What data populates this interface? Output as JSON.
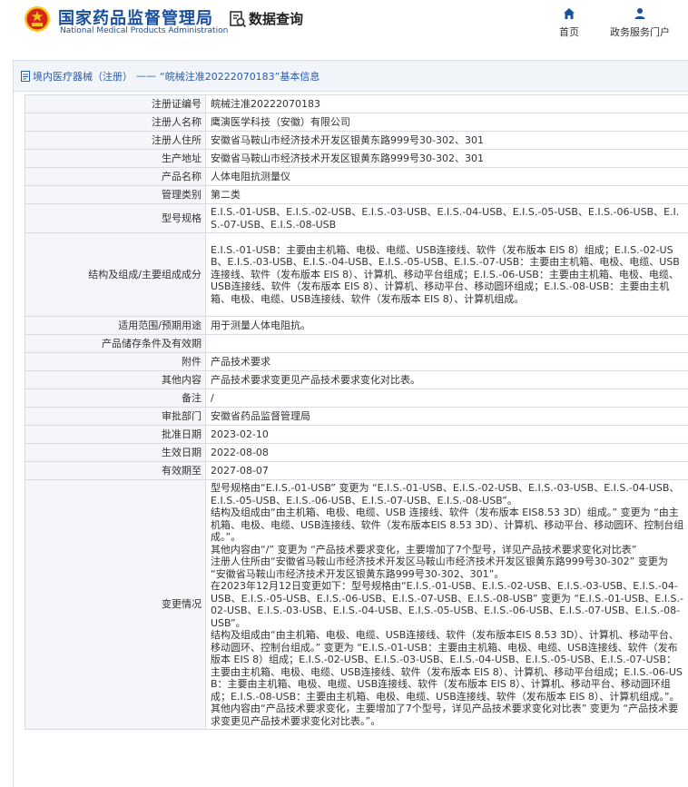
{
  "header": {
    "logo_cn": "国家药品监督管理局",
    "logo_en": "National Medical Products Administration",
    "query_label": "数据查询",
    "nav": [
      {
        "label": "首页",
        "icon": "home-icon"
      },
      {
        "label": "政务服务门户",
        "icon": "user-icon"
      }
    ]
  },
  "breadcrumb": {
    "link": "境内医疗器械（注册）",
    "separator": "——",
    "current": "“皖械注准20222070183”基本信息"
  },
  "rows": [
    {
      "label": "注册证编号",
      "value": "皖械注准20222070183"
    },
    {
      "label": "注册人名称",
      "value": "鹰演医学科技（安徽）有限公司"
    },
    {
      "label": "注册人住所",
      "value": "安徽省马鞍山市经济技术开发区银黄东路999号30-302、301"
    },
    {
      "label": "生产地址",
      "value": "安徽省马鞍山市经济技术开发区银黄东路999号30-302、301"
    },
    {
      "label": "产品名称",
      "value": "人体电阻抗测量仪"
    },
    {
      "label": "管理类别",
      "value": "第二类"
    },
    {
      "label": "型号规格",
      "value": "E.I.S.-01-USB、E.I.S.-02-USB、E.I.S.-03-USB、E.I.S.-04-USB、E.I.S.-05-USB、E.I.S.-06-USB、E.I.S.-07-USB、E.I.S.-08-USB"
    },
    {
      "label": "结构及组成/主要组成成分",
      "value": "E.I.S.-01-USB：主要由主机箱、电极、电缆、USB连接线、软件（发布版本 EIS 8）组成；E.I.S.-02-USB、E.I.S.-03-USB、E.I.S.-04-USB、E.I.S.-05-USB、E.I.S.-07-USB：主要由主机箱、电极、电缆、USB连接线、软件（发布版本 EIS 8）、计算机、移动平台组成；E.I.S.-06-USB：主要由主机箱、电极、电缆、USB连接线、软件（发布版本 EIS 8）、计算机、移动平台、移动圆环组成；E.I.S.-08-USB：主要由主机箱、电极、电缆、USB连接线、软件（发布版本 EIS 8）、计算机组成。"
    },
    {
      "label": "适用范围/预期用途",
      "value": "用于测量人体电阻抗。"
    },
    {
      "label": "产品储存条件及有效期",
      "value": ""
    },
    {
      "label": "附件",
      "value": "产品技术要求"
    },
    {
      "label": "其他内容",
      "value": "产品技术要求变更见产品技术要求变化对比表。"
    },
    {
      "label": "备注",
      "value": "/"
    },
    {
      "label": "审批部门",
      "value": "安徽省药品监督管理局"
    },
    {
      "label": "批准日期",
      "value": "2023-02-10"
    },
    {
      "label": "生效日期",
      "value": "2022-08-08"
    },
    {
      "label": "有效期至",
      "value": "2027-08-07"
    }
  ],
  "change_row": {
    "label": "变更情况",
    "lines": [
      "型号规格由“E.I.S.-01-USB” 变更为 “E.I.S.-01-USB、E.I.S.-02-USB、E.I.S.-03-USB、E.I.S.-04-USB、E.I.S.-05-USB、E.I.S.-06-USB、E.I.S.-07-USB、E.I.S.-08-USB”。",
      "结构及组成由“由主机箱、电极、电缆、USB 连接线、软件（发布版本 EIS8.53 3D）组成。” 变更为 “由主机箱、电极、电缆、USB连接线、软件（发布版本EIS 8.53 3D）、计算机、移动平台、移动圆环、控制台组成。”。",
      "其他内容由“/” 变更为 “产品技术要求变化，主要增加了7个型号，详见产品技术要求变化对比表”",
      "注册人住所由“安徽省马鞍山市经济技术开发区马鞍山市经济技术开发区银黄东路999号30-302” 变更为 “安徽省马鞍山市经济技术开发区银黄东路999号30-302、301”。",
      "在2023年12月12日变更如下：型号规格由“E.I.S.-01-USB、E.I.S.-02-USB、E.I.S.-03-USB、E.I.S.-04-USB、E.I.S.-05-USB、E.I.S.-06-USB、E.I.S.-07-USB、E.I.S.-08-USB” 变更为 “E.I.S.-01-USB、E.I.S.-02-USB、E.I.S.-03-USB、E.I.S.-04-USB、E.I.S.-05-USB、E.I.S.-06-USB、E.I.S.-07-USB、E.I.S.-08-USB”。",
      "结构及组成由“由主机箱、电极、电缆、USB连接线、软件（发布版本EIS 8.53 3D）、计算机、移动平台、移动圆环、控制台组成。” 变更为 “E.I.S.-01-USB：主要由主机箱、电极、电缆、USB连接线、软件（发布版本 EIS 8）组成；E.I.S.-02-USB、E.I.S.-03-USB、E.I.S.-04-USB、E.I.S.-05-USB、E.I.S.-07-USB：主要由主机箱、电极、电缆、USB连接线、软件（发布版本 EIS 8）、计算机、移动平台组成；E.I.S.-06-USB：主要由主机箱、电极、电缆、USB连接线、软件（发布版本 EIS 8）、计算机、移动平台、移动圆环组成；E.I.S.-08-USB：主要由主机箱、电极、电缆、USB连接线、软件（发布版本 EIS 8）、计算机组成。”。",
      "其他内容由“产品技术要求变化，主要增加了7个型号，详见产品技术要求变化对比表” 变更为 “产品技术要求变更见产品技术要求变化对比表。”。"
    ]
  },
  "colors": {
    "brand_blue": "#1a4f9c",
    "link_blue": "#2a5caa",
    "emblem_red": "#d6261c",
    "emblem_gold": "#f5c518",
    "label_bg": "#f4f6f9",
    "border": "#d9dde3"
  }
}
